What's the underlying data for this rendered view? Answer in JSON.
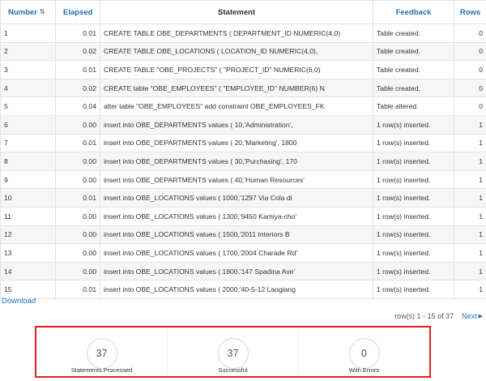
{
  "table": {
    "headers": {
      "number": "Number",
      "elapsed": "Elapsed",
      "statement": "Statement",
      "feedback": "Feedback",
      "rows": "Rows"
    },
    "rows": [
      {
        "number": "1",
        "elapsed": "0.01",
        "statement": "CREATE TABLE OBE_DEPARTMENTS ( DEPARTMENT_ID NUMERIC(4,0)",
        "feedback": "Table created.",
        "rows": "0"
      },
      {
        "number": "2",
        "elapsed": "0.02",
        "statement": "CREATE TABLE OBE_LOCATIONS ( LOCATION_ID NUMERIC(4,0),",
        "feedback": "Table created.",
        "rows": "0"
      },
      {
        "number": "3",
        "elapsed": "0.01",
        "statement": "CREATE TABLE \"OBE_PROJECTS\" ( \"PROJECT_ID\" NUMERIC(6,0)",
        "feedback": "Table created.",
        "rows": "0"
      },
      {
        "number": "4",
        "elapsed": "0.02",
        "statement": "CREATE table \"OBE_EMPLOYEES\" ( \"EMPLOYEE_ID\" NUMBER(6) N",
        "feedback": "Table created.",
        "rows": "0"
      },
      {
        "number": "5",
        "elapsed": "0.04",
        "statement": "alter table \"OBE_EMPLOYEES\" add constraint OBE_EMPLOYEES_FK",
        "feedback": "Table altered.",
        "rows": "0"
      },
      {
        "number": "6",
        "elapsed": "0.00",
        "statement": "insert into OBE_DEPARTMENTS values ( 10,'Administration',",
        "feedback": "1 row(s) inserted.",
        "rows": "1"
      },
      {
        "number": "7",
        "elapsed": "0.01",
        "statement": "insert into OBE_DEPARTMENTS values ( 20,'Marketing', 1800",
        "feedback": "1 row(s) inserted.",
        "rows": "1"
      },
      {
        "number": "8",
        "elapsed": "0.00",
        "statement": "insert into OBE_DEPARTMENTS values ( 30,'Purchasing', 170",
        "feedback": "1 row(s) inserted.",
        "rows": "1"
      },
      {
        "number": "9",
        "elapsed": "0.00",
        "statement": "insert into OBE_DEPARTMENTS values ( 40,'Human Resources'",
        "feedback": "1 row(s) inserted.",
        "rows": "1"
      },
      {
        "number": "10",
        "elapsed": "0.01",
        "statement": "insert into OBE_LOCATIONS values ( 1000,'1297 Via Cola di",
        "feedback": "1 row(s) inserted.",
        "rows": "1"
      },
      {
        "number": "11",
        "elapsed": "0.00",
        "statement": "insert into OBE_LOCATIONS values ( 1300,'9450 Kamiya-cho'",
        "feedback": "1 row(s) inserted.",
        "rows": "1"
      },
      {
        "number": "12",
        "elapsed": "0.00",
        "statement": "insert into OBE_LOCATIONS values ( 1500,'2011 Interiors B",
        "feedback": "1 row(s) inserted.",
        "rows": "1"
      },
      {
        "number": "13",
        "elapsed": "0.00",
        "statement": "insert into OBE_LOCATIONS values ( 1700,'2004 Charade Rd'",
        "feedback": "1 row(s) inserted.",
        "rows": "1"
      },
      {
        "number": "14",
        "elapsed": "0.00",
        "statement": "insert into OBE_LOCATIONS values ( 1800,'147 Spadina Ave'",
        "feedback": "1 row(s) inserted.",
        "rows": "1"
      },
      {
        "number": "15",
        "elapsed": "0.01",
        "statement": "insert into OBE_LOCATIONS values ( 2000,'40-5-12 Laogiang",
        "feedback": "1 row(s) inserted.",
        "rows": "1"
      }
    ]
  },
  "download_label": "Download",
  "pagination": {
    "range": "row(s) 1 - 15 of 37",
    "next": "Next"
  },
  "summary": [
    {
      "value": "37",
      "label": "Statements Processed"
    },
    {
      "value": "37",
      "label": "Successful"
    },
    {
      "value": "0",
      "label": "With Errors"
    }
  ],
  "icons": {
    "sort": "sort-ascending-icon",
    "next": "triangle-right-icon"
  },
  "colors": {
    "link": "#1f6fb5",
    "highlight_border": "#d9241c"
  }
}
